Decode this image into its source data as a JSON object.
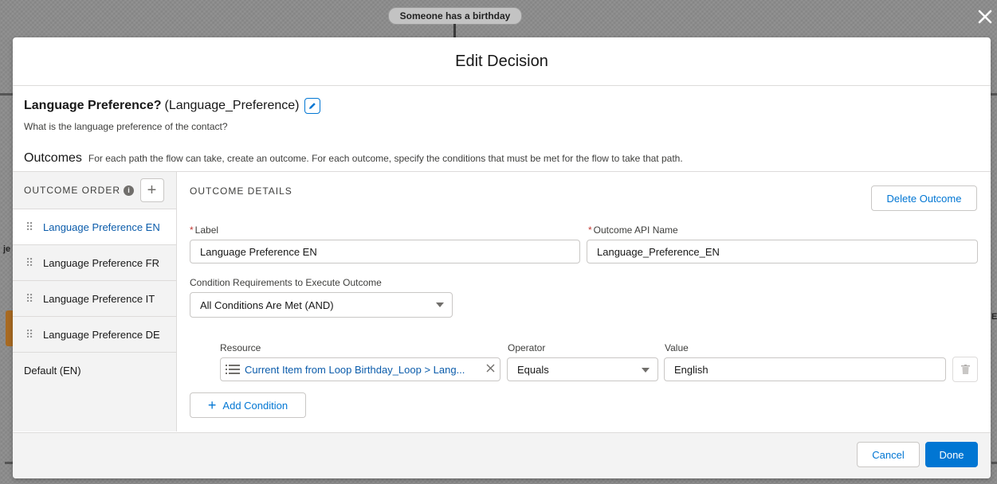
{
  "backdrop": {
    "start_node_label": "Someone has a birthday"
  },
  "modal": {
    "title": "Edit Decision",
    "close_icon": "close-icon"
  },
  "decision": {
    "label": "Language Preference?",
    "api_name": "(Language_Preference)",
    "description": "What is the language preference of the contact?"
  },
  "outcomes": {
    "title": "Outcomes",
    "help": "For each path the flow can take, create an outcome. For each outcome, specify the conditions that must be met for the flow to take that path."
  },
  "sidebar": {
    "header": "OUTCOME ORDER",
    "info_glyph": "i",
    "add_glyph": "+",
    "grip_glyph": "⠿",
    "items": [
      {
        "label": "Language Preference EN",
        "active": true
      },
      {
        "label": "Language Preference FR",
        "active": false
      },
      {
        "label": "Language Preference IT",
        "active": false
      },
      {
        "label": "Language Preference DE",
        "active": false
      }
    ],
    "default_label": "Default (EN)"
  },
  "details": {
    "header": "OUTCOME DETAILS",
    "delete_label": "Delete Outcome",
    "required_mark": "*",
    "label_field": {
      "label": "Label",
      "value": "Language Preference EN"
    },
    "api_field": {
      "label": "Outcome API Name",
      "value": "Language_Preference_EN"
    },
    "condition_req": {
      "label": "Condition Requirements to Execute Outcome",
      "value": "All Conditions Are Met (AND)"
    },
    "condition": {
      "resource_label": "Resource",
      "resource_value": "Current Item from Loop Birthday_Loop > Lang...",
      "operator_label": "Operator",
      "operator_value": "Equals",
      "value_label": "Value",
      "value_value": "English"
    },
    "add_condition_label": "Add Condition",
    "add_glyph": "+"
  },
  "footer": {
    "cancel_label": "Cancel",
    "done_label": "Done"
  },
  "colors": {
    "brand": "#0176d3",
    "link": "#0b5cab",
    "required": "#c23934"
  }
}
